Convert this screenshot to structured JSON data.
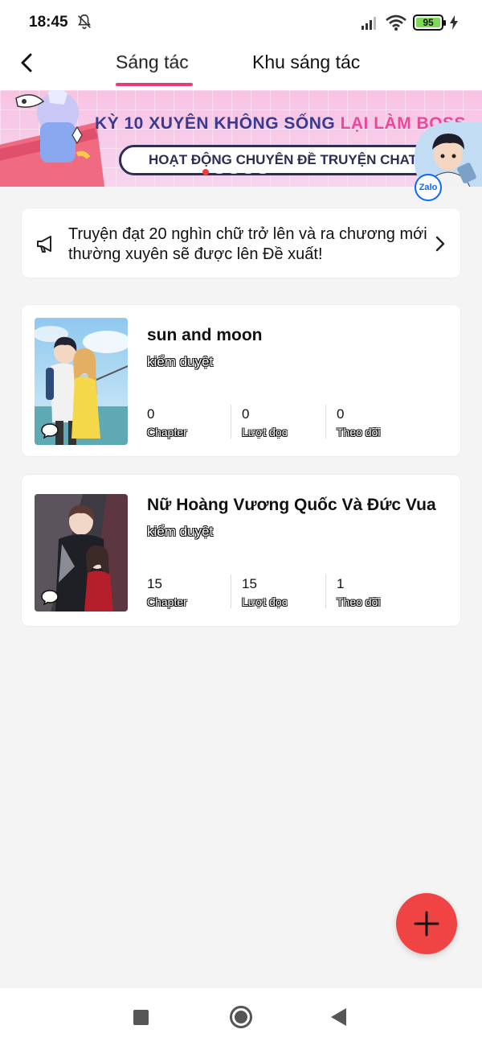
{
  "status_bar": {
    "time": "18:45",
    "battery": "95"
  },
  "header": {
    "tabs": [
      {
        "label": "Sáng tác",
        "active": true
      },
      {
        "label": "Khu sáng tác",
        "active": false
      }
    ]
  },
  "banner": {
    "title_part1": "KỲ 10 XUYÊN KHÔNG SỐNG ",
    "title_part2": "LẠI LÀM BOSS",
    "subtitle": "HOẠT ĐỘNG CHUYÊN ĐỀ TRUYỆN CHAT",
    "slide_count": 5,
    "active_slide": 0,
    "zalo_label": "Zalo"
  },
  "notice": {
    "text": "Truyện đạt 20 nghìn chữ trở lên và ra chương mới thường xuyên sẽ được lên Đề xuất!"
  },
  "stories": [
    {
      "title": "sun and moon",
      "status": "kiểm duyệt",
      "stats": [
        {
          "value": "0",
          "label": "Chapter"
        },
        {
          "value": "0",
          "label": "Lượt đọc"
        },
        {
          "value": "0",
          "label": "Theo dõi"
        }
      ]
    },
    {
      "title": "Nữ Hoàng Vương Quốc Và Đức Vua",
      "status": "kiểm duyệt",
      "stats": [
        {
          "value": "15",
          "label": "Chapter"
        },
        {
          "value": "15",
          "label": "Lượt đọc"
        },
        {
          "value": "1",
          "label": "Theo dõi"
        }
      ]
    }
  ],
  "colors": {
    "accent": "#e93a74",
    "fab": "#f04444",
    "background": "#f4f4f4"
  }
}
